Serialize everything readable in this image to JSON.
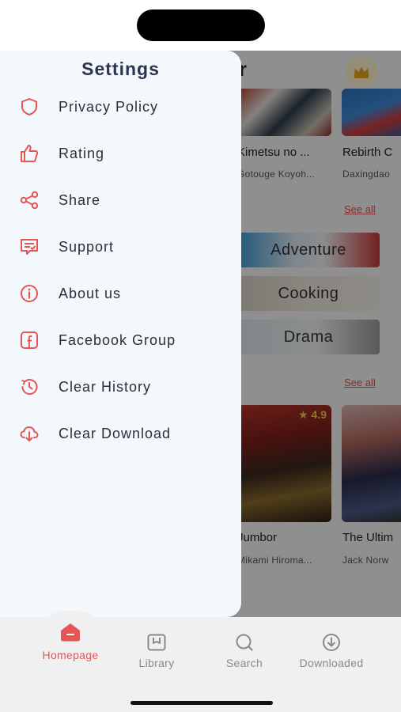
{
  "drawer": {
    "title": "Settings",
    "items": [
      {
        "label": "Privacy Policy",
        "icon": "shield-icon"
      },
      {
        "label": "Rating",
        "icon": "thumbs-up-icon"
      },
      {
        "label": "Share",
        "icon": "share-icon"
      },
      {
        "label": "Support",
        "icon": "support-chat-icon"
      },
      {
        "label": "About us",
        "icon": "info-icon"
      },
      {
        "label": "Facebook Group",
        "icon": "facebook-icon"
      },
      {
        "label": "Clear History",
        "icon": "history-icon"
      },
      {
        "label": "Clear Download",
        "icon": "cloud-download-icon"
      }
    ]
  },
  "background": {
    "title_fragment": "der",
    "popular": [
      {
        "title": "Kimetsu no ...",
        "author": "Gotouge Koyoh..."
      },
      {
        "title": "Rebirth C",
        "author": "Daxingdao"
      }
    ],
    "see_all_label": "See all",
    "genres": [
      "Adventure",
      "Cooking",
      "Drama"
    ],
    "featured": [
      {
        "title": "Jumbor",
        "author": "Mikami Hiroma...",
        "rating": "4.9"
      },
      {
        "title": "The Ultim",
        "author": "Jack Norw"
      }
    ]
  },
  "bottom_nav": {
    "items": [
      {
        "label": "Homepage",
        "icon": "home-icon",
        "active": true
      },
      {
        "label": "Library",
        "icon": "library-icon",
        "active": false
      },
      {
        "label": "Search",
        "icon": "search-icon",
        "active": false
      },
      {
        "label": "Downloaded",
        "icon": "download-icon",
        "active": false
      }
    ]
  },
  "colors": {
    "accent": "#e65454",
    "drawer_bg": "#f3f8fd",
    "text_dark": "#2b2f3a",
    "nav_inactive": "#8a8a8a"
  }
}
